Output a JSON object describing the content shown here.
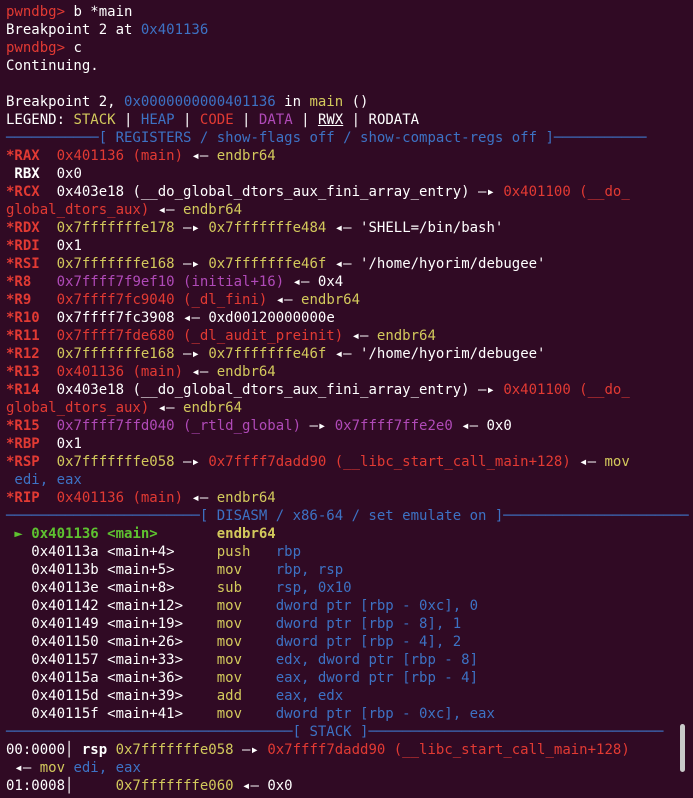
{
  "lines": [
    [
      {
        "t": "pwndbg> ",
        "c": "c-prompt"
      },
      {
        "t": "b *main",
        "c": "c-white"
      }
    ],
    [
      {
        "t": "Breakpoint 2 at ",
        "c": "c-white"
      },
      {
        "t": "0x401136",
        "c": "c-blue"
      }
    ],
    [
      {
        "t": "pwndbg> ",
        "c": "c-prompt"
      },
      {
        "t": "c",
        "c": "c-white"
      }
    ],
    [
      {
        "t": "Continuing.",
        "c": "c-white"
      }
    ],
    [
      {
        "t": " ",
        "c": "c-white"
      }
    ],
    [
      {
        "t": "Breakpoint 2, ",
        "c": "c-white"
      },
      {
        "t": "0x0000000000401136",
        "c": "c-blue"
      },
      {
        "t": " in ",
        "c": "c-white"
      },
      {
        "t": "main",
        "c": "c-yellow"
      },
      {
        "t": " ()",
        "c": "c-white"
      }
    ],
    [
      {
        "t": "LEGEND: ",
        "c": "c-white"
      },
      {
        "t": "STACK",
        "c": "c-yellow"
      },
      {
        "t": " | ",
        "c": "c-white"
      },
      {
        "t": "HEAP",
        "c": "c-blue"
      },
      {
        "t": " | ",
        "c": "c-white"
      },
      {
        "t": "CODE",
        "c": "c-red"
      },
      {
        "t": " | ",
        "c": "c-white"
      },
      {
        "t": "DATA",
        "c": "c-purple"
      },
      {
        "t": " | ",
        "c": "c-white"
      },
      {
        "t": "RWX",
        "c": "c-white u"
      },
      {
        "t": " | RODATA",
        "c": "c-white"
      }
    ],
    [
      {
        "t": "───────────[ ",
        "c": "c-blue"
      },
      {
        "t": "REGISTERS / show-flags off / show-compact-regs off",
        "c": "c-blue"
      },
      {
        "t": " ]───────────",
        "c": "c-blue"
      }
    ],
    [
      {
        "t": "*RAX ",
        "c": "c-red b"
      },
      {
        "t": " 0x401136 (main)",
        "c": "c-red"
      },
      {
        "t": " ◂— ",
        "c": "c-white"
      },
      {
        "t": "endbr64",
        "c": "c-yellow"
      }
    ],
    [
      {
        "t": " RBX ",
        "c": "c-white b"
      },
      {
        "t": " 0x0",
        "c": "c-white"
      }
    ],
    [
      {
        "t": "*RCX ",
        "c": "c-red b"
      },
      {
        "t": " 0x403e18 (__do_global_dtors_aux_fini_array_entry)",
        "c": "c-white"
      },
      {
        "t": " —▸ ",
        "c": "c-white"
      },
      {
        "t": "0x401100 (__do_",
        "c": "c-red"
      }
    ],
    [
      {
        "t": "global_dtors_aux)",
        "c": "c-red"
      },
      {
        "t": " ◂— ",
        "c": "c-white"
      },
      {
        "t": "endbr64",
        "c": "c-yellow"
      }
    ],
    [
      {
        "t": "*RDX ",
        "c": "c-red b"
      },
      {
        "t": " 0x7fffffffe178",
        "c": "c-yellow"
      },
      {
        "t": " —▸ ",
        "c": "c-white"
      },
      {
        "t": "0x7fffffffe484",
        "c": "c-yellow"
      },
      {
        "t": " ◂— ",
        "c": "c-white"
      },
      {
        "t": "'SHELL=/bin/bash'",
        "c": "c-white"
      }
    ],
    [
      {
        "t": "*RDI ",
        "c": "c-red b"
      },
      {
        "t": " 0x1",
        "c": "c-white"
      }
    ],
    [
      {
        "t": "*RSI ",
        "c": "c-red b"
      },
      {
        "t": " 0x7fffffffe168",
        "c": "c-yellow"
      },
      {
        "t": " —▸ ",
        "c": "c-white"
      },
      {
        "t": "0x7fffffffe46f",
        "c": "c-yellow"
      },
      {
        "t": " ◂— ",
        "c": "c-white"
      },
      {
        "t": "'/home/hyorim/debugee'",
        "c": "c-white"
      }
    ],
    [
      {
        "t": "*R8  ",
        "c": "c-red b"
      },
      {
        "t": " 0x7ffff7f9ef10 (initial+16)",
        "c": "c-purple"
      },
      {
        "t": " ◂— ",
        "c": "c-white"
      },
      {
        "t": "0x4",
        "c": "c-white"
      }
    ],
    [
      {
        "t": "*R9  ",
        "c": "c-red b"
      },
      {
        "t": " 0x7ffff7fc9040 (_dl_fini)",
        "c": "c-red"
      },
      {
        "t": " ◂— ",
        "c": "c-white"
      },
      {
        "t": "endbr64",
        "c": "c-yellow"
      }
    ],
    [
      {
        "t": "*R10 ",
        "c": "c-red b"
      },
      {
        "t": " 0x7ffff7fc3908",
        "c": "c-white"
      },
      {
        "t": " ◂— ",
        "c": "c-white"
      },
      {
        "t": "0xd00120000000e",
        "c": "c-white"
      }
    ],
    [
      {
        "t": "*R11 ",
        "c": "c-red b"
      },
      {
        "t": " 0x7ffff7fde680 (_dl_audit_preinit)",
        "c": "c-red"
      },
      {
        "t": " ◂— ",
        "c": "c-white"
      },
      {
        "t": "endbr64",
        "c": "c-yellow"
      }
    ],
    [
      {
        "t": "*R12 ",
        "c": "c-red b"
      },
      {
        "t": " 0x7fffffffe168",
        "c": "c-yellow"
      },
      {
        "t": " —▸ ",
        "c": "c-white"
      },
      {
        "t": "0x7fffffffe46f",
        "c": "c-yellow"
      },
      {
        "t": " ◂— ",
        "c": "c-white"
      },
      {
        "t": "'/home/hyorim/debugee'",
        "c": "c-white"
      }
    ],
    [
      {
        "t": "*R13 ",
        "c": "c-red b"
      },
      {
        "t": " 0x401136 (main)",
        "c": "c-red"
      },
      {
        "t": " ◂— ",
        "c": "c-white"
      },
      {
        "t": "endbr64",
        "c": "c-yellow"
      }
    ],
    [
      {
        "t": "*R14 ",
        "c": "c-red b"
      },
      {
        "t": " 0x403e18 (__do_global_dtors_aux_fini_array_entry)",
        "c": "c-white"
      },
      {
        "t": " —▸ ",
        "c": "c-white"
      },
      {
        "t": "0x401100 (__do_",
        "c": "c-red"
      }
    ],
    [
      {
        "t": "global_dtors_aux)",
        "c": "c-red"
      },
      {
        "t": " ◂— ",
        "c": "c-white"
      },
      {
        "t": "endbr64",
        "c": "c-yellow"
      }
    ],
    [
      {
        "t": "*R15 ",
        "c": "c-red b"
      },
      {
        "t": " 0x7ffff7ffd040 (_rtld_global)",
        "c": "c-purple"
      },
      {
        "t": " —▸ ",
        "c": "c-white"
      },
      {
        "t": "0x7ffff7ffe2e0",
        "c": "c-purple"
      },
      {
        "t": " ◂— ",
        "c": "c-white"
      },
      {
        "t": "0x0",
        "c": "c-white"
      }
    ],
    [
      {
        "t": "*RBP ",
        "c": "c-red b"
      },
      {
        "t": " 0x1",
        "c": "c-white"
      }
    ],
    [
      {
        "t": "*RSP ",
        "c": "c-red b"
      },
      {
        "t": " 0x7fffffffe058",
        "c": "c-yellow"
      },
      {
        "t": " —▸ ",
        "c": "c-white"
      },
      {
        "t": "0x7ffff7dadd90 (__libc_start_call_main+128)",
        "c": "c-red"
      },
      {
        "t": " ◂— ",
        "c": "c-white"
      },
      {
        "t": "mov",
        "c": "c-yellow"
      }
    ],
    [
      {
        "t": " edi, eax",
        "c": "c-blue"
      }
    ],
    [
      {
        "t": "*RIP ",
        "c": "c-red b"
      },
      {
        "t": " 0x401136 (main)",
        "c": "c-red"
      },
      {
        "t": " ◂— ",
        "c": "c-white"
      },
      {
        "t": "endbr64",
        "c": "c-yellow"
      }
    ],
    [
      {
        "t": "───────────────────────[ ",
        "c": "c-blue"
      },
      {
        "t": "DISASM / x86-64 / set emulate on",
        "c": "c-blue"
      },
      {
        "t": " ]──────────────────────",
        "c": "c-blue"
      }
    ],
    [
      {
        "t": " ► ",
        "c": "c-green b"
      },
      {
        "t": "0x401136 <main>       ",
        "c": "c-green b"
      },
      {
        "t": "endbr64",
        "c": "c-yellow b"
      }
    ],
    [
      {
        "t": "   0x40113a <main+4>     ",
        "c": "c-white"
      },
      {
        "t": "push   ",
        "c": "c-yellow"
      },
      {
        "t": "rbp",
        "c": "c-blue"
      }
    ],
    [
      {
        "t": "   0x40113b <main+5>     ",
        "c": "c-white"
      },
      {
        "t": "mov    ",
        "c": "c-yellow"
      },
      {
        "t": "rbp, rsp",
        "c": "c-blue"
      }
    ],
    [
      {
        "t": "   0x40113e <main+8>     ",
        "c": "c-white"
      },
      {
        "t": "sub    ",
        "c": "c-yellow"
      },
      {
        "t": "rsp, 0x10",
        "c": "c-blue"
      }
    ],
    [
      {
        "t": "   0x401142 <main+12>    ",
        "c": "c-white"
      },
      {
        "t": "mov    ",
        "c": "c-yellow"
      },
      {
        "t": "dword ptr [rbp - 0xc], 0",
        "c": "c-blue"
      }
    ],
    [
      {
        "t": "   0x401149 <main+19>    ",
        "c": "c-white"
      },
      {
        "t": "mov    ",
        "c": "c-yellow"
      },
      {
        "t": "dword ptr [rbp - 8], 1",
        "c": "c-blue"
      }
    ],
    [
      {
        "t": "   0x401150 <main+26>    ",
        "c": "c-white"
      },
      {
        "t": "mov    ",
        "c": "c-yellow"
      },
      {
        "t": "dword ptr [rbp - 4], 2",
        "c": "c-blue"
      }
    ],
    [
      {
        "t": "   0x401157 <main+33>    ",
        "c": "c-white"
      },
      {
        "t": "mov    ",
        "c": "c-yellow"
      },
      {
        "t": "edx, dword ptr [rbp - 8]",
        "c": "c-blue"
      }
    ],
    [
      {
        "t": "   0x40115a <main+36>    ",
        "c": "c-white"
      },
      {
        "t": "mov    ",
        "c": "c-yellow"
      },
      {
        "t": "eax, dword ptr [rbp - 4]",
        "c": "c-blue"
      }
    ],
    [
      {
        "t": "   0x40115d <main+39>    ",
        "c": "c-white"
      },
      {
        "t": "add    ",
        "c": "c-yellow"
      },
      {
        "t": "eax, edx",
        "c": "c-blue"
      }
    ],
    [
      {
        "t": "   0x40115f <main+41>    ",
        "c": "c-white"
      },
      {
        "t": "mov    ",
        "c": "c-yellow"
      },
      {
        "t": "dword ptr [rbp - 0xc], eax",
        "c": "c-blue"
      }
    ],
    [
      {
        "t": "──────────────────────────────────[ ",
        "c": "c-blue"
      },
      {
        "t": "STACK",
        "c": "c-blue"
      },
      {
        "t": " ]───────────────────────────────────",
        "c": "c-blue"
      }
    ],
    [
      {
        "t": "00:0000│ ",
        "c": "c-white"
      },
      {
        "t": "rsp ",
        "c": "c-white b"
      },
      {
        "t": "0x7fffffffe058",
        "c": "c-yellow"
      },
      {
        "t": " —▸ ",
        "c": "c-white"
      },
      {
        "t": "0x7ffff7dadd90 (__libc_start_call_main+128)",
        "c": "c-red"
      }
    ],
    [
      {
        "t": " ◂— ",
        "c": "c-white"
      },
      {
        "t": "mov ",
        "c": "c-yellow"
      },
      {
        "t": "edi, eax",
        "c": "c-blue"
      }
    ],
    [
      {
        "t": "01:0008│     ",
        "c": "c-white"
      },
      {
        "t": "0x7fffffffe060",
        "c": "c-yellow"
      },
      {
        "t": " ◂— ",
        "c": "c-white"
      },
      {
        "t": "0x0",
        "c": "c-white"
      }
    ]
  ]
}
